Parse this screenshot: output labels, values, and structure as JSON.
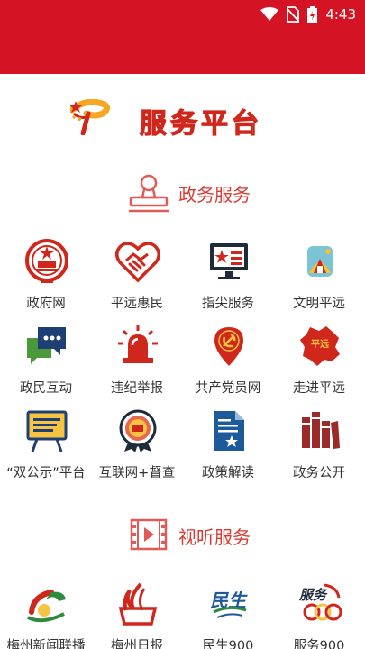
{
  "status": {
    "time": "4:43"
  },
  "banner": {
    "title": "服务平台"
  },
  "sections": [
    {
      "title": "政务服务"
    },
    {
      "title": "视听服务"
    }
  ],
  "gov_services": [
    {
      "label": "政府网",
      "icon": "national-emblem-icon"
    },
    {
      "label": "平远惠民",
      "icon": "heart-handshake-icon"
    },
    {
      "label": "指尖服务",
      "icon": "monitor-star-icon"
    },
    {
      "label": "文明平远",
      "icon": "civilization-logo-icon"
    },
    {
      "label": "政民互动",
      "icon": "chat-bubbles-icon"
    },
    {
      "label": "违纪举报",
      "icon": "alarm-siren-icon"
    },
    {
      "label": "共产党员网",
      "icon": "party-pin-icon"
    },
    {
      "label": "走进平远",
      "icon": "pingyuan-map-icon"
    },
    {
      "label": "“双公示”平台",
      "icon": "notice-board-icon"
    },
    {
      "label": "互联网+督查",
      "icon": "inspection-badge-icon"
    },
    {
      "label": "政策解读",
      "icon": "policy-document-icon"
    },
    {
      "label": "政务公开",
      "icon": "books-icon"
    }
  ],
  "media_services": [
    {
      "label": "梅州新闻联播",
      "icon": "news-broadcast-logo-icon"
    },
    {
      "label": "梅州日报",
      "icon": "daily-paper-logo-icon"
    },
    {
      "label": "民生900",
      "icon": "minsheng-logo-icon"
    },
    {
      "label": "服务900",
      "icon": "service-900-logo-icon"
    }
  ],
  "colors": {
    "brand_red": "#d41324",
    "section_red": "#d83a32",
    "banner_gold": "#f5a623",
    "icon_navy": "#1d3f73"
  }
}
